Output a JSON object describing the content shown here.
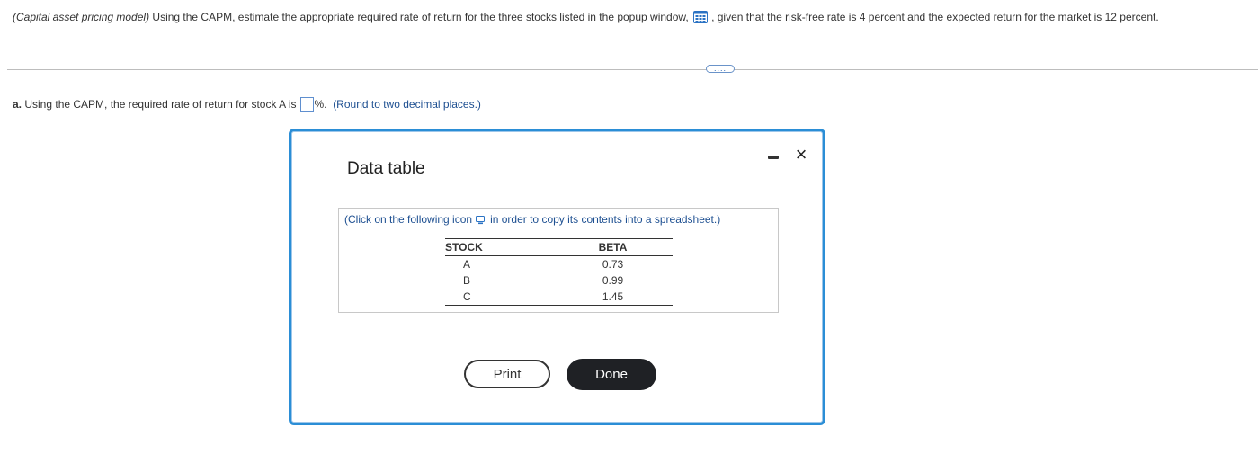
{
  "question": {
    "italic_part": "(Capital asset pricing model)",
    "text_before_icon": " Using the CAPM, estimate the appropriate required rate of return for the three stocks listed in the popup window,",
    "icon": "table-icon",
    "text_after_icon": ", given that the risk-free rate is 4 percent and the expected return for the market is 12 percent."
  },
  "expand_button": {
    "label": "....",
    "icon": "ellipsis-icon"
  },
  "part_a": {
    "label": "a.",
    "text": " Using the CAPM, the required rate of return for stock A is",
    "answer_value": "",
    "suffix": "%.",
    "hint": "(Round to two decimal places.)"
  },
  "popup": {
    "title": "Data table",
    "minimize_icon": "minimize-icon",
    "close_label": "×",
    "copy_hint_before": "(Click on the following icon",
    "copy_hint_after": "in order to copy its contents into a spreadsheet.)",
    "table": {
      "headers": [
        "STOCK",
        "BETA"
      ],
      "rows": [
        [
          "A",
          "0.73"
        ],
        [
          "B",
          "0.99"
        ],
        [
          "C",
          "1.45"
        ]
      ]
    },
    "print_label": "Print",
    "done_label": "Done"
  },
  "colors": {
    "accent_blue": "#2b8ed6",
    "link_blue": "#1d4f91",
    "done_bg": "#1f2125"
  }
}
